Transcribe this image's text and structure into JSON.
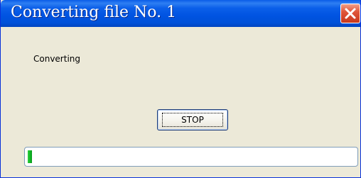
{
  "window": {
    "title": "Converting file No. 1",
    "close_icon": "close-icon"
  },
  "content": {
    "status_text": "Converting",
    "stop_label": "STOP"
  },
  "progress": {
    "percent": 1
  },
  "colors": {
    "title_bar": "#0054e3",
    "close_button": "#e0563a",
    "dialog_background": "#ece9d8",
    "progress_fill": "#0fb524"
  }
}
